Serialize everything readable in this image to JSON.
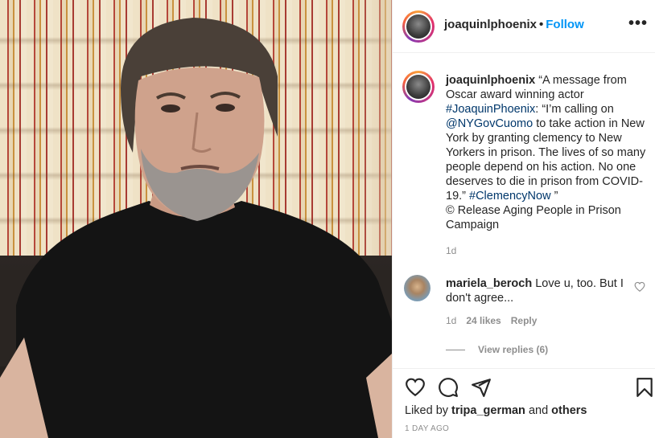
{
  "post": {
    "username": "joaquinlphoenix",
    "follow_label": "Follow",
    "separator": "•",
    "more_label": "•••"
  },
  "caption": {
    "username": "joaquinlphoenix",
    "text_1": " “A message from Oscar award winning actor ",
    "hashtag_1": "#JoaquinPhoenix",
    "text_2": ": “I’m calling on ",
    "mention": "@NYGovCuomo",
    "text_3": " to take action in New York by granting clemency to New Yorkers in prison. The lives of so many people depend on his action. No one deserves to die in prison from COVID-19.” ",
    "hashtag_2": "#ClemencyNow",
    "text_4": " ”",
    "text_5": "© Release Aging People in Prison Campaign",
    "time": "1d"
  },
  "comment": {
    "username": "mariela_beroch",
    "text": " Love u, too. But I don't agree...",
    "time": "1d",
    "likes": "24 likes",
    "reply_label": "Reply",
    "view_replies": "View replies (6)"
  },
  "footer": {
    "liked_prefix": "Liked by ",
    "liked_user": "tripa_german",
    "liked_and": " and ",
    "liked_others": "others",
    "timestamp": "1 DAY AGO"
  },
  "icons": [
    "heart-icon",
    "comment-icon",
    "share-icon",
    "bookmark-icon",
    "more-icon",
    "heart-outline-small-icon"
  ],
  "colors": {
    "link": "#0095f6",
    "tag": "#00376b",
    "muted": "#8e8e8e",
    "text": "#262626"
  }
}
